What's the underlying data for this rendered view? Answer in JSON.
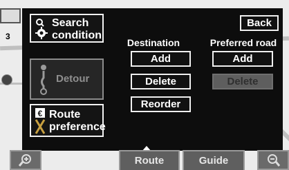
{
  "panel": {
    "back_label": "Back",
    "search_condition_label": "Search\ncondition",
    "detour_label": "Detour",
    "route_preference_label": "Route\npreference",
    "destination": {
      "heading": "Destination",
      "add": "Add",
      "delete": "Delete",
      "reorder": "Reorder"
    },
    "preferred_road": {
      "heading": "Preferred road",
      "add": "Add",
      "delete": "Delete"
    }
  },
  "bottom_bar": {
    "route": "Route",
    "guide": "Guide"
  },
  "map": {
    "marker_number": "3"
  },
  "colors": {
    "panel_bg": "#0d0d0d",
    "button_border": "#f2f2f2",
    "disabled_text": "#8f8f8f",
    "bottom_bar_bg": "#5f5f5f"
  },
  "icons": [
    "gear-search-icon",
    "detour-icon",
    "route-preference-icon",
    "zoom-in-icon",
    "zoom-out-icon"
  ]
}
